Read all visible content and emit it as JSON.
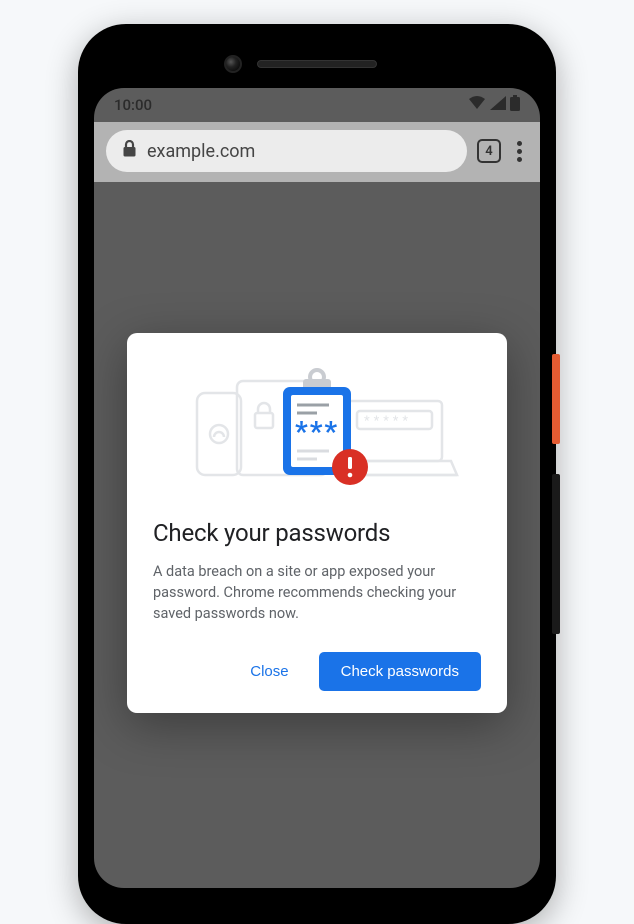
{
  "status_bar": {
    "time": "10:00"
  },
  "browser": {
    "url": "example.com",
    "tab_count": "4"
  },
  "dialog": {
    "title": "Check your passwords",
    "body": "A data breach on a site or app exposed your password. Chrome recommends checking your saved passwords now.",
    "close_label": "Close",
    "check_label": "Check passwords"
  },
  "colors": {
    "primary": "#1a73e8",
    "alert": "#d93025"
  }
}
